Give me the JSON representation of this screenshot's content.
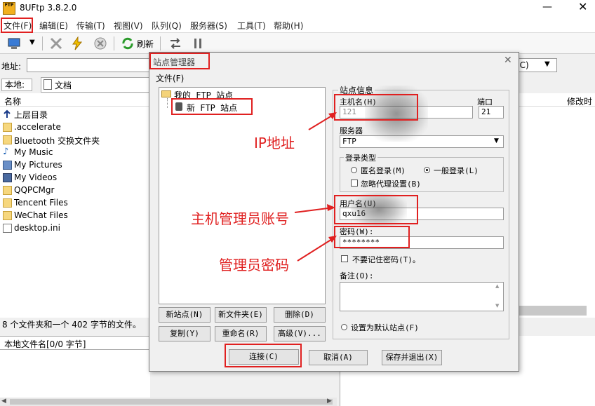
{
  "window": {
    "title": "8UFtp 3.8.2.0",
    "icon_text": "FTP"
  },
  "menu": [
    "文件(F)",
    "编辑(E)",
    "传输(T)",
    "视图(V)",
    "队列(Q)",
    "服务器(S)",
    "工具(T)",
    "帮助(H)"
  ],
  "toolbar": {
    "refresh_label": "刷新"
  },
  "address": {
    "label": "地址:",
    "value": "",
    "connect_type": "(C)"
  },
  "local": {
    "label": "本地:",
    "path": "文档",
    "column_name": "名称",
    "files": [
      "上层目录",
      ".accelerate",
      "Bluetooth 交换文件夹",
      "My Music",
      "My Pictures",
      "My Videos",
      "QQPCMgr",
      "Tencent Files",
      "WeChat Files",
      "desktop.ini"
    ],
    "status": "8 个文件夹和一个 402 字节的文件。",
    "queue_header": "本地文件名[0/0 字节]"
  },
  "remote": {
    "column_modified": "修改时"
  },
  "dialog": {
    "title": "站点管理器",
    "menu_file": "文件(F)",
    "tree_root": "我的 FTP 站点",
    "tree_node": "新 FTP 站点",
    "buttons": {
      "new_site": "新站点(N)",
      "new_folder": "新文件夹(E)",
      "delete": "删除(D)",
      "copy": "复制(Y)",
      "rename": "重命名(R)",
      "advanced": "高级(V)...",
      "connect": "连接(C)",
      "cancel": "取消(A)",
      "save_exit": "保存并退出(X)"
    },
    "site_info": {
      "group_title": "站点信息",
      "host_label": "主机名(H)",
      "host_value": "121",
      "port_label": "端口",
      "port_value": "21",
      "server_type_label": "服务器",
      "server_type_value": "FTP",
      "login_type_label": "登录类型",
      "anonymous_login": "匿名登录(M)",
      "normal_login": "一般登录(L)",
      "ignore_proxy": "忽略代理设置(B)",
      "username_label": "用户名(U)",
      "username_value": "qxu16",
      "password_label": "密码(W):",
      "password_value": "********",
      "no_remember_pwd": "不要记住密码(T)。",
      "note_label": "备注(O):",
      "note_value": "",
      "set_default": "设置为默认站点(F)"
    }
  },
  "annotations": {
    "ip": "IP地址",
    "account": "主机管理员账号",
    "password": "管理员密码"
  },
  "colors": {
    "highlight": "#e02020"
  }
}
